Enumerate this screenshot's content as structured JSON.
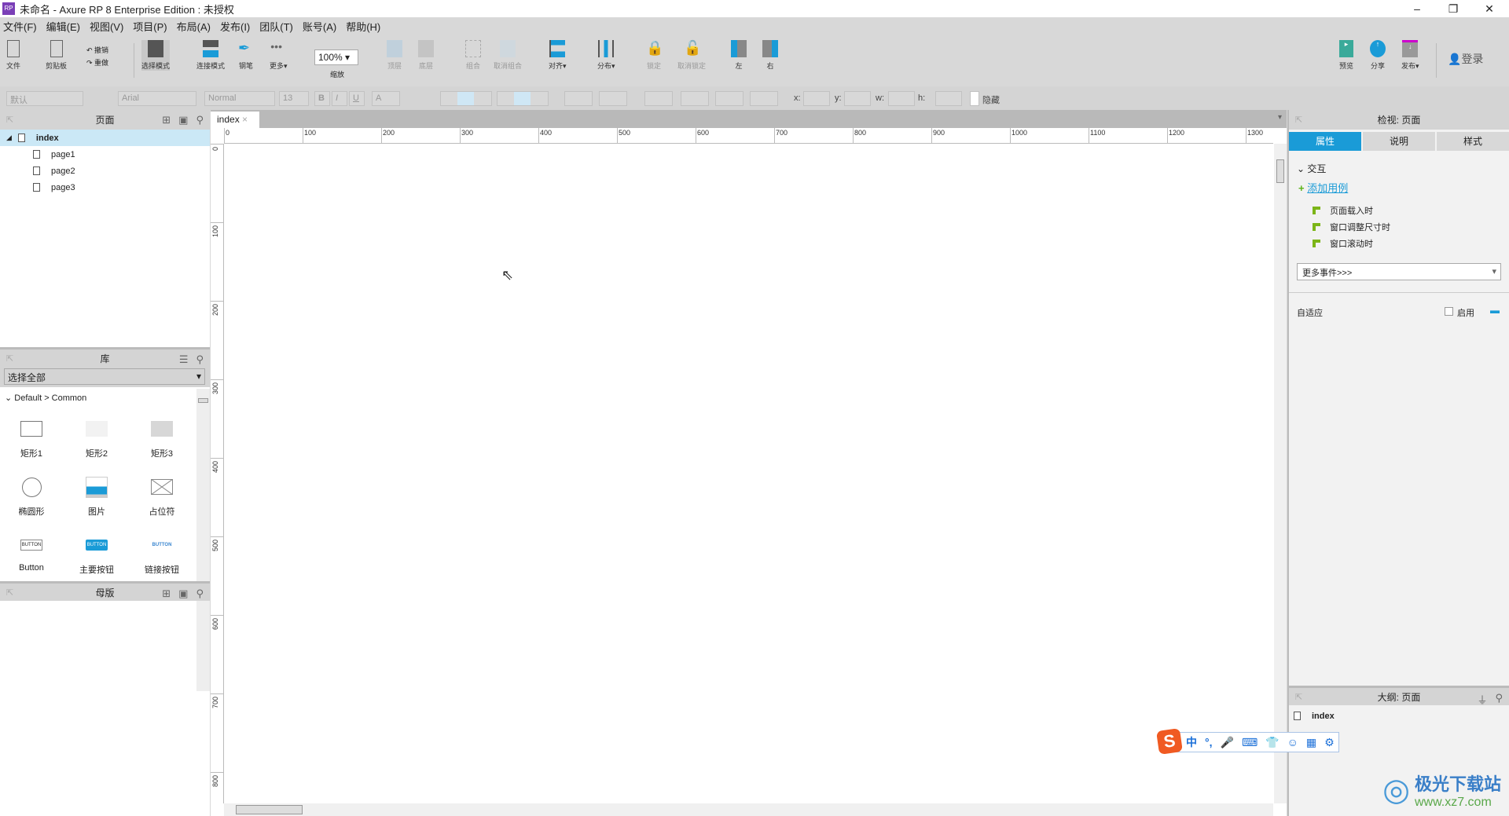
{
  "window": {
    "title": "未命名 - Axure RP 8 Enterprise Edition : 未授权",
    "logo": "RP",
    "minimize": "–",
    "restore": "❐",
    "close": "✕"
  },
  "menu": [
    "文件(F)",
    "编辑(E)",
    "视图(V)",
    "项目(P)",
    "布局(A)",
    "发布(I)",
    "团队(T)",
    "账号(A)",
    "帮助(H)"
  ],
  "toolbar": {
    "file": "文件",
    "clipboard": "剪贴板",
    "undo": "撤销",
    "redo": "重做",
    "select_mode": "选择模式",
    "connect_mode": "连接模式",
    "pen": "钢笔",
    "more": "更多▾",
    "zoom_value": "100%",
    "zoom": "缩放",
    "top": "顶层",
    "bottom": "底层",
    "group": "组合",
    "ungroup": "取消组合",
    "align": "对齐▾",
    "distribute": "分布▾",
    "lock": "锁定",
    "unlock": "取消锁定",
    "left": "左",
    "right": "右",
    "preview": "预览",
    "share": "分享",
    "publish": "发布▾",
    "login": "登录"
  },
  "format": {
    "style": "默认",
    "font": "Arial",
    "weight": "Normal",
    "size": "13",
    "bold": "B",
    "italic": "I",
    "underline": "U",
    "text_color": "A",
    "x": "x:",
    "y": "y:",
    "w": "w:",
    "h": "h:",
    "hidden": "隐藏"
  },
  "pages": {
    "title": "页面",
    "root": "index",
    "children": [
      "page1",
      "page2",
      "page3"
    ]
  },
  "library": {
    "title": "库",
    "select": "选择全部",
    "group": "Default > Common",
    "widgets": [
      "矩形1",
      "矩形2",
      "矩形3",
      "椭圆形",
      "图片",
      "占位符",
      "Button",
      "主要按钮",
      "链接按钮"
    ],
    "button_text": "BUTTON"
  },
  "masters": {
    "title": "母版"
  },
  "canvas": {
    "tab": "index",
    "tab_close": "×",
    "hticks": [
      "0",
      "100",
      "200",
      "300",
      "400",
      "500",
      "600",
      "700",
      "800",
      "900",
      "1000",
      "1100",
      "1200",
      "1300"
    ],
    "vticks": [
      "0",
      "100",
      "200",
      "300",
      "400",
      "500",
      "600",
      "700",
      "800"
    ]
  },
  "inspector": {
    "title": "检视: 页面",
    "tabs": [
      "属性",
      "说明",
      "样式"
    ],
    "section": "交互",
    "add_case": "添加用例",
    "events": [
      "页面载入时",
      "窗口调整尺寸时",
      "窗口滚动时"
    ],
    "more_events": "更多事件>>>",
    "adaptive": "自适应",
    "enable": "启用",
    "accent": "#1a9bd7"
  },
  "outline": {
    "title": "大纲: 页面",
    "item": "index"
  },
  "ime": {
    "logo": "S",
    "items": [
      "中",
      "°,",
      "🎤",
      "⌨",
      "👕",
      "☺",
      "▦",
      "⚙"
    ]
  },
  "watermark": {
    "name": "极光下载站",
    "url": "www.xz7.com"
  }
}
